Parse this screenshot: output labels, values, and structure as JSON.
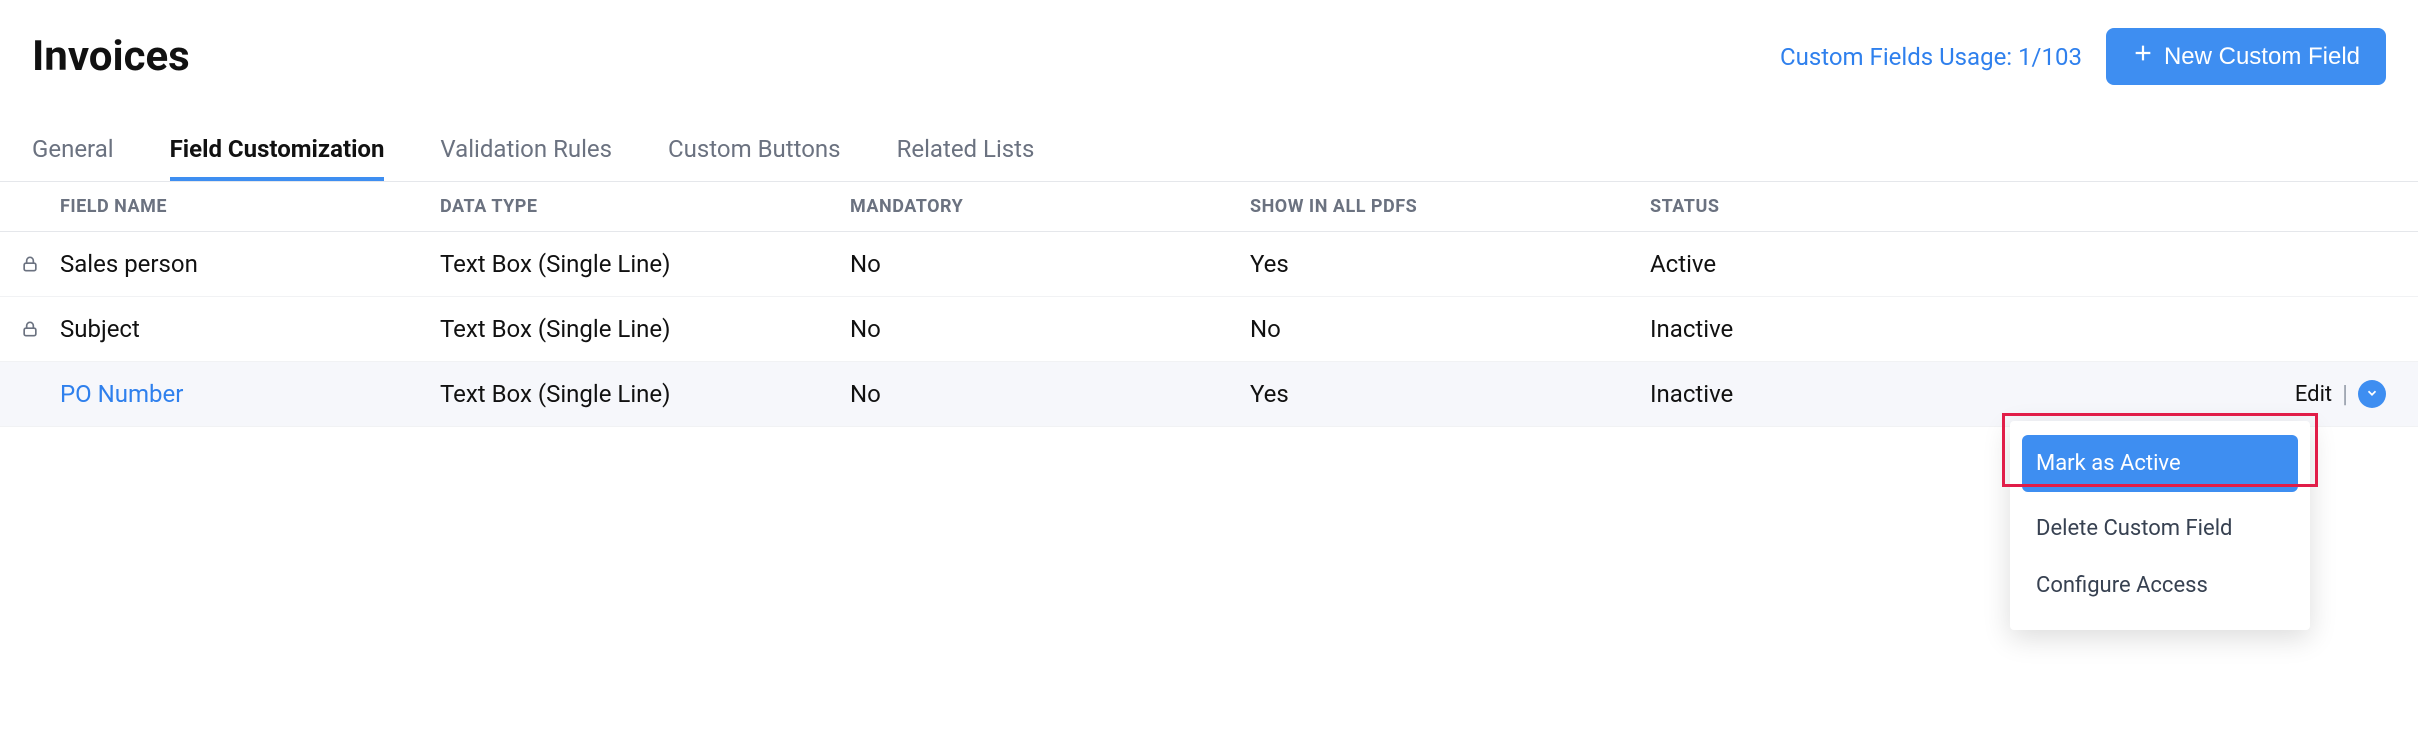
{
  "header": {
    "title": "Invoices",
    "usage_label": "Custom Fields Usage: 1/103",
    "new_button": "New Custom Field"
  },
  "tabs": [
    {
      "label": "General",
      "active": false
    },
    {
      "label": "Field Customization",
      "active": true
    },
    {
      "label": "Validation Rules",
      "active": false
    },
    {
      "label": "Custom Buttons",
      "active": false
    },
    {
      "label": "Related Lists",
      "active": false
    }
  ],
  "columns": {
    "field_name": "FIELD NAME",
    "data_type": "DATA TYPE",
    "mandatory": "MANDATORY",
    "show_pdfs": "SHOW IN ALL PDFS",
    "status": "STATUS"
  },
  "rows": [
    {
      "locked": true,
      "name": "Sales person",
      "link": false,
      "type": "Text Box (Single Line)",
      "mandatory": "No",
      "show": "Yes",
      "status": "Active",
      "hover": false
    },
    {
      "locked": true,
      "name": "Subject",
      "link": false,
      "type": "Text Box (Single Line)",
      "mandatory": "No",
      "show": "No",
      "status": "Inactive",
      "hover": false
    },
    {
      "locked": false,
      "name": "PO Number",
      "link": true,
      "type": "Text Box (Single Line)",
      "mandatory": "No",
      "show": "Yes",
      "status": "Inactive",
      "hover": true
    }
  ],
  "row_actions": {
    "edit": "Edit"
  },
  "dropdown": {
    "mark_active": "Mark as Active",
    "delete": "Delete Custom Field",
    "configure": "Configure Access"
  }
}
